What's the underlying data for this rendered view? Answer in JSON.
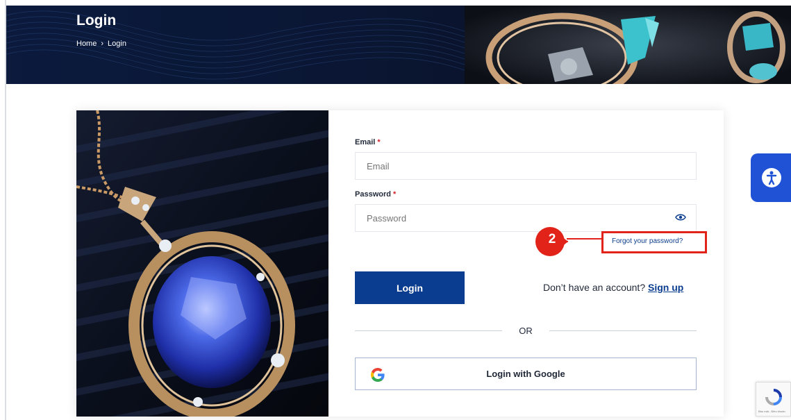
{
  "hero": {
    "title": "Login",
    "breadcrumb": {
      "home": "Home",
      "separator": "›",
      "current": "Login"
    }
  },
  "form": {
    "email_label": "Email",
    "email_placeholder": "Email",
    "password_label": "Password",
    "password_placeholder": "Password",
    "required_mark": "*",
    "forgot_link": "Forgot your password?",
    "login_button": "Login",
    "signup_prompt": "Don’t have an account?",
    "signup_link": "Sign up",
    "divider_text": "OR",
    "google_button": "Login with Google"
  },
  "annotation": {
    "step_number": "2",
    "color": "#e2231a"
  },
  "icons": {
    "password_toggle": "eye-icon",
    "accessibility": "accessibility-icon",
    "google": "google-icon"
  },
  "recaptcha": {
    "footer_text": "Bảo mật - Điều khoản"
  },
  "colors": {
    "primary": "#0a3d8f",
    "hero_bg": "#0b1a3d",
    "accessibility_button": "#2052d6"
  }
}
